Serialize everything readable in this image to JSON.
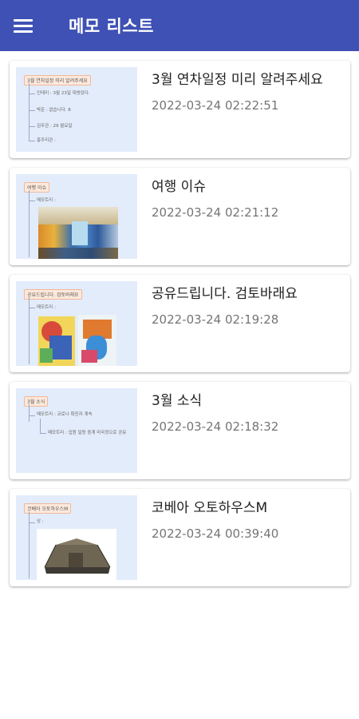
{
  "appbar": {
    "title": "메모 리스트",
    "menu_icon": "hamburger-menu-icon",
    "color": "#3f51b5"
  },
  "memos": [
    {
      "title": "3월 연차일정 미리 알려주세요",
      "date": "2022-03-24 02:22:51",
      "thumb": {
        "root": "3월 연차일정 미리 알려주세요",
        "nodes": [
          "인태미 : 3월 23일 대방았다.",
          "박준 : 없습니다. 8",
          "김무관 : 29 월요일",
          "홍주리관 :"
        ]
      }
    },
    {
      "title": "여행 이슈",
      "date": "2022-03-24 02:21:12",
      "thumb": {
        "root": "여행 이슈",
        "nodes": [
          "메모트리 :"
        ]
      }
    },
    {
      "title": "공유드립니다. 검토바래요",
      "date": "2022-03-24 02:19:28",
      "thumb": {
        "root": "공유드립니다. 검토바래요",
        "nodes": [
          "메모트리 :"
        ]
      }
    },
    {
      "title": "3월 소식",
      "date": "2022-03-24 02:18:32",
      "thumb": {
        "root": "3월 소식",
        "nodes": [
          "메모트리 : 코로나 확진자 계속",
          "메모트리 : 입원 일렁 중계 미국정으로 공유"
        ]
      }
    },
    {
      "title": "코베아 오토하우스M",
      "date": "2022-03-24 00:39:40",
      "thumb": {
        "root": "코베아 오토하우스M",
        "nodes": [
          "상 :"
        ]
      }
    }
  ]
}
